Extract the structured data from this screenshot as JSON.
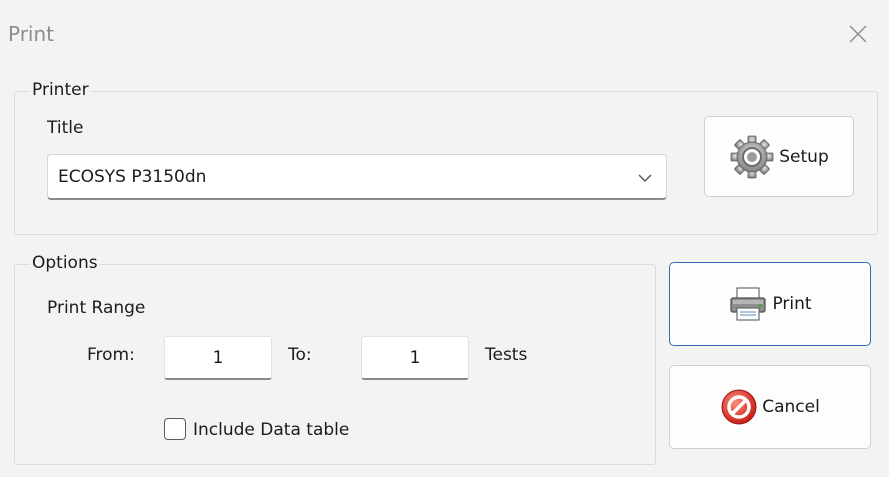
{
  "window": {
    "title": "Print"
  },
  "printer_group": {
    "label": "Printer",
    "title_label": "Title",
    "printer_select": {
      "value": "ECOSYS P3150dn"
    },
    "setup_button": {
      "label": "Setup",
      "icon": "gear-icon"
    }
  },
  "options_group": {
    "label": "Options",
    "print_range_label": "Print Range",
    "from_label": "From:",
    "from_value": "1",
    "to_label": "To:",
    "to_value": "1",
    "units_label": "Tests",
    "include_data_table": {
      "label": "Include Data table",
      "checked": false
    }
  },
  "actions": {
    "print_button": {
      "label": "Print",
      "icon": "printer-icon"
    },
    "cancel_button": {
      "label": "Cancel",
      "icon": "cancel-icon"
    }
  },
  "colors": {
    "accent_border": "#2c6fb1",
    "cancel_red": "#e3332f"
  }
}
